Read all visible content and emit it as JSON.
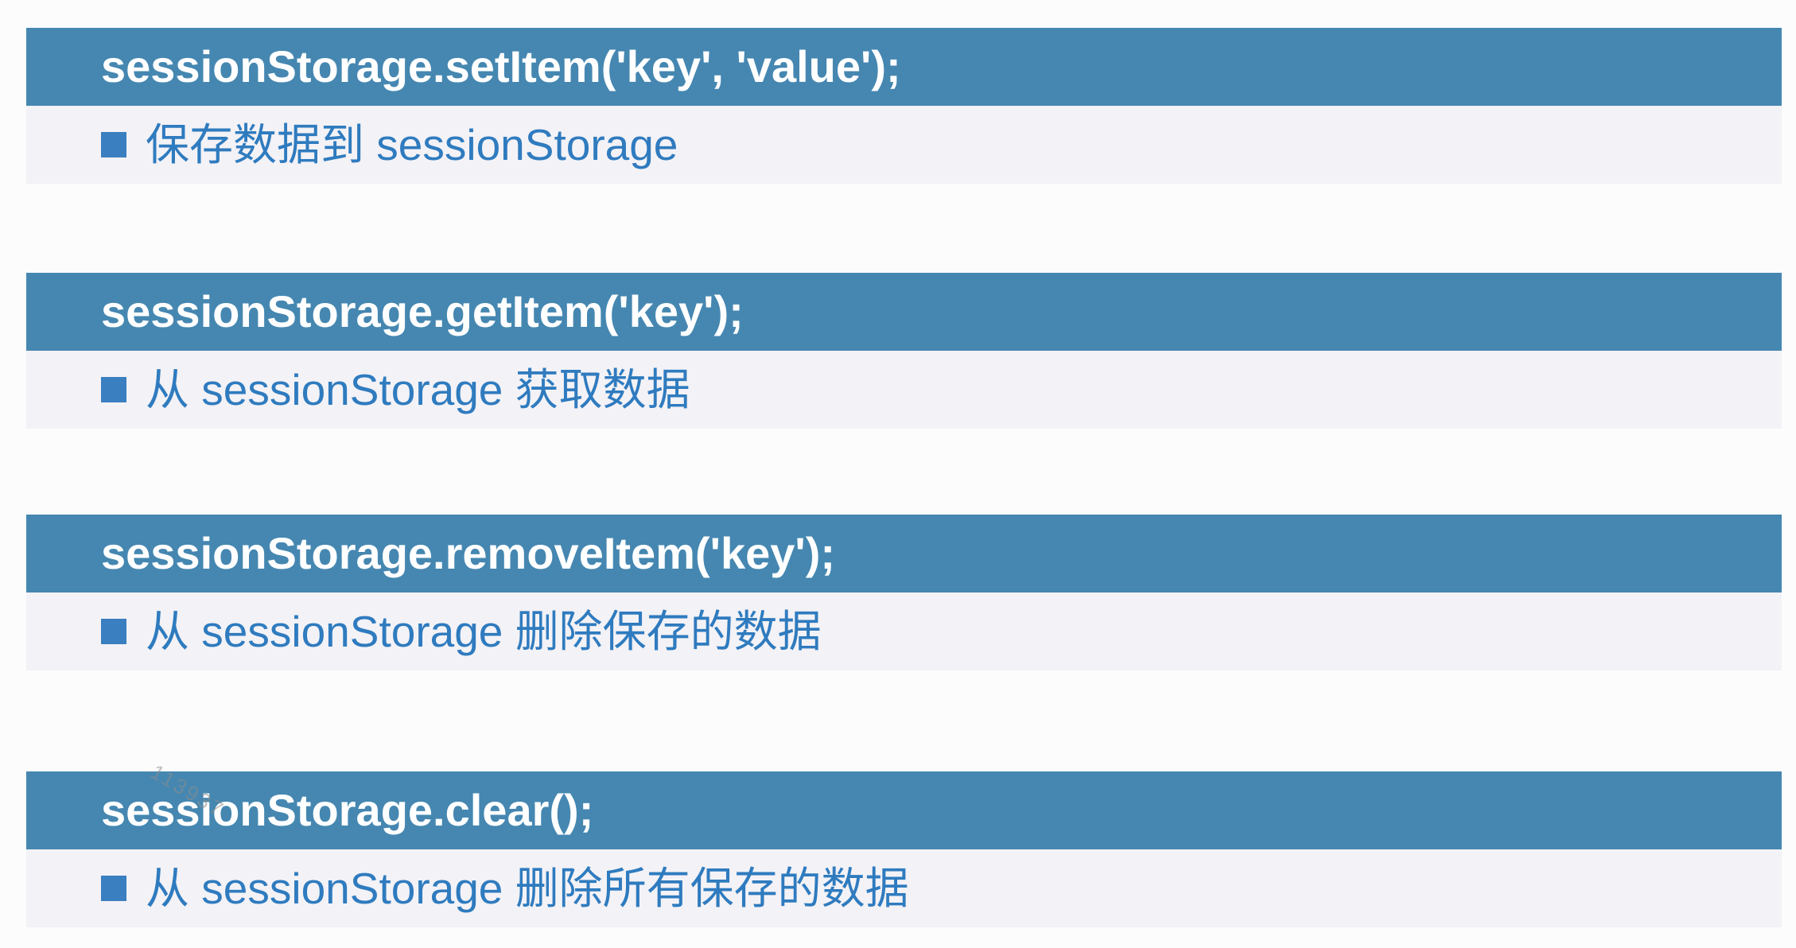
{
  "items": [
    {
      "code": "sessionStorage.setItem('key', 'value');",
      "description": "保存数据到 sessionStorage"
    },
    {
      "code": "sessionStorage.getItem('key');",
      "description": "从 sessionStorage 获取数据"
    },
    {
      "code": "sessionStorage.removeItem('key');",
      "description": "从 sessionStorage 删除保存的数据"
    },
    {
      "code": "sessionStorage.clear();",
      "description": "从 sessionStorage 删除所有保存的数据"
    }
  ],
  "bullet_icon": "square-bullet",
  "watermark": "113937",
  "colors": {
    "page": "#fcfcfd",
    "header": "#4587b1",
    "body": "#f3f2f6",
    "accent": "#3a7fc0",
    "text": "#2f7bbf"
  }
}
